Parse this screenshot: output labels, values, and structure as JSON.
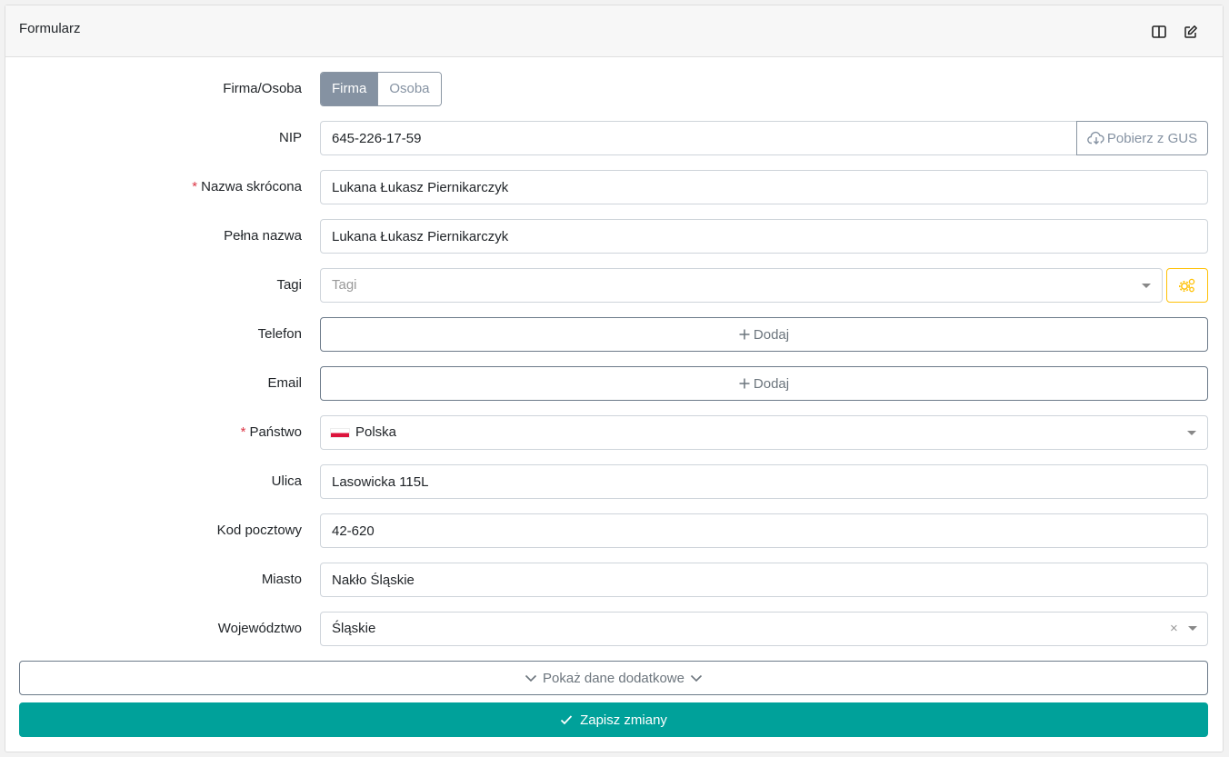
{
  "card": {
    "title": "Formularz",
    "header_icons": [
      "columns-icon",
      "edit-icon"
    ]
  },
  "form": {
    "type": {
      "label": "Firma/Osoba",
      "options": [
        "Firma",
        "Osoba"
      ],
      "selected": "Firma"
    },
    "nip": {
      "label": "NIP",
      "value": "645-226-17-59",
      "gus_button": "Pobierz z GUS"
    },
    "short_name": {
      "label": "Nazwa skrócona",
      "required": "*",
      "value": "Lukana Łukasz Piernikarczyk"
    },
    "full_name": {
      "label": "Pełna nazwa",
      "value": "Lukana Łukasz Piernikarczyk"
    },
    "tags": {
      "label": "Tagi",
      "placeholder": "Tagi"
    },
    "phone": {
      "label": "Telefon",
      "add_label": "Dodaj"
    },
    "email": {
      "label": "Email",
      "add_label": "Dodaj"
    },
    "country": {
      "label": "Państwo",
      "required": "*",
      "value": "Polska"
    },
    "street": {
      "label": "Ulica",
      "value": "Lasowicka 115L"
    },
    "postal_code": {
      "label": "Kod pocztowy",
      "value": "42-620"
    },
    "city": {
      "label": "Miasto",
      "value": "Nakło Śląskie"
    },
    "voivodeship": {
      "label": "Województwo",
      "value": "Śląskie",
      "clear": "×"
    },
    "show_more": "Pokaż dane dodatkowe",
    "save": "Zapisz zmiany"
  },
  "colors": {
    "save_button": "#00a19a",
    "gear_border": "#ffc107",
    "required": "#dc3545",
    "segment_active": "#8592a2"
  }
}
